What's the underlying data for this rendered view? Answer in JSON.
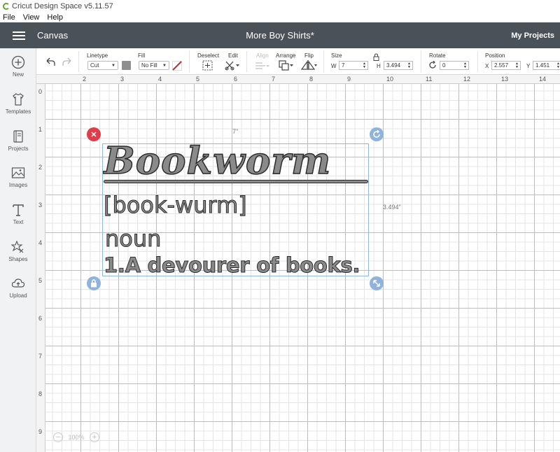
{
  "os": {
    "app_title": "Cricut Design Space  v5.11.57",
    "menu": [
      "File",
      "View",
      "Help"
    ]
  },
  "header": {
    "section": "Canvas",
    "project_title": "More Boy Shirts*",
    "my_projects": "My Projects"
  },
  "sidebar": {
    "items": [
      {
        "label": "New",
        "icon": "plus-circle-icon"
      },
      {
        "label": "Templates",
        "icon": "shirt-icon"
      },
      {
        "label": "Projects",
        "icon": "book-icon"
      },
      {
        "label": "Images",
        "icon": "image-icon"
      },
      {
        "label": "Text",
        "icon": "text-icon"
      },
      {
        "label": "Shapes",
        "icon": "shapes-icon"
      },
      {
        "label": "Upload",
        "icon": "cloud-upload-icon"
      }
    ]
  },
  "toolbar": {
    "linetype_label": "Linetype",
    "linetype_value": "Cut",
    "fill_label": "Fill",
    "fill_value": "No Fill",
    "fill_color": "#8e8e8e",
    "deselect_label": "Deselect",
    "edit_label": "Edit",
    "align_label": "Align",
    "arrange_label": "Arrange",
    "flip_label": "Flip",
    "size_label": "Size",
    "w_label": "W",
    "w_value": "7",
    "h_label": "H",
    "h_value": "3.494",
    "rotate_label": "Rotate",
    "rotate_value": "0",
    "position_label": "Position",
    "x_label": "X",
    "x_value": "2.557",
    "y_label": "Y",
    "y_value": "1.451"
  },
  "ruler": {
    "top": [
      "2",
      "3",
      "4",
      "5",
      "6",
      "7",
      "8",
      "9",
      "10",
      "11",
      "12",
      "13",
      "14"
    ],
    "left": [
      "0",
      "1",
      "2",
      "3",
      "4",
      "5",
      "6",
      "7",
      "8",
      "9"
    ]
  },
  "selection": {
    "width_label": "7\"",
    "height_label": "3.494\""
  },
  "design": {
    "headline": "Bookworm",
    "pronunciation": "[book-wurm]",
    "part_of_speech": "noun",
    "definition": "1.A devourer of books."
  },
  "zoom": {
    "level": "100%"
  },
  "colors": {
    "header_bg": "#4a5259",
    "delete_handle": "#e03c4a",
    "blue_handle": "#8fb3dc"
  }
}
